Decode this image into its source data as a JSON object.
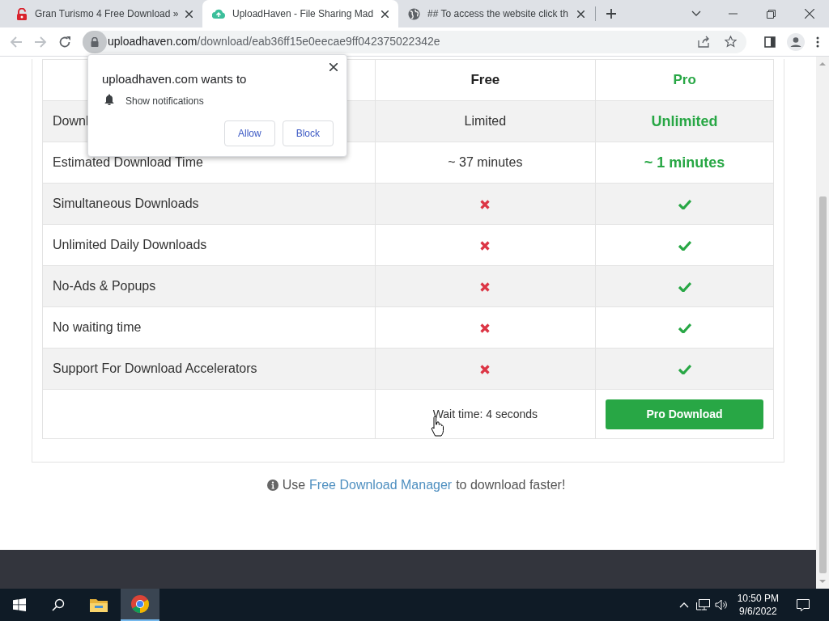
{
  "tabs": [
    {
      "title": "Gran Turismo 4 Free Download »",
      "selected": false
    },
    {
      "title": "UploadHaven - File Sharing Mad",
      "selected": true
    },
    {
      "title": "## To access the website click th",
      "selected": false
    }
  ],
  "address": {
    "host": "uploadhaven.com",
    "path": "/download/eab36ff15e0eecae9ff042375022342e"
  },
  "table": {
    "columns": [
      "",
      "Free",
      "Pro"
    ],
    "rows": [
      {
        "feature": "Downl",
        "free": {
          "kind": "text",
          "text": "Limited"
        },
        "pro": {
          "kind": "text",
          "text": "Unlimited"
        }
      },
      {
        "feature": "Estimated Download Time",
        "free": {
          "kind": "text",
          "text": "~ 37 minutes"
        },
        "pro": {
          "kind": "text",
          "text": "~ 1 minutes"
        }
      },
      {
        "feature": "Simultaneous Downloads",
        "free": {
          "kind": "mark",
          "available": false
        },
        "pro": {
          "kind": "mark",
          "available": true
        }
      },
      {
        "feature": "Unlimited Daily Downloads",
        "free": {
          "kind": "mark",
          "available": false
        },
        "pro": {
          "kind": "mark",
          "available": true
        }
      },
      {
        "feature": "No-Ads & Popups",
        "free": {
          "kind": "mark",
          "available": false
        },
        "pro": {
          "kind": "mark",
          "available": true
        }
      },
      {
        "feature": "No waiting time",
        "free": {
          "kind": "mark",
          "available": false
        },
        "pro": {
          "kind": "mark",
          "available": true
        }
      },
      {
        "feature": "Support For Download Accelerators",
        "free": {
          "kind": "mark",
          "available": false
        },
        "pro": {
          "kind": "mark",
          "available": true
        }
      }
    ],
    "wait_text": "Wait time: 4 seconds",
    "pro_button": "Pro Download"
  },
  "tip": {
    "before": "Use",
    "link": "Free Download Manager",
    "after": "to download faster!"
  },
  "popup": {
    "title": "uploadhaven.com wants to",
    "permission": "Show notifications",
    "buttons": [
      "Allow",
      "Block"
    ]
  },
  "taskbar": {
    "time": "10:50 PM",
    "date": "9/6/2022"
  }
}
